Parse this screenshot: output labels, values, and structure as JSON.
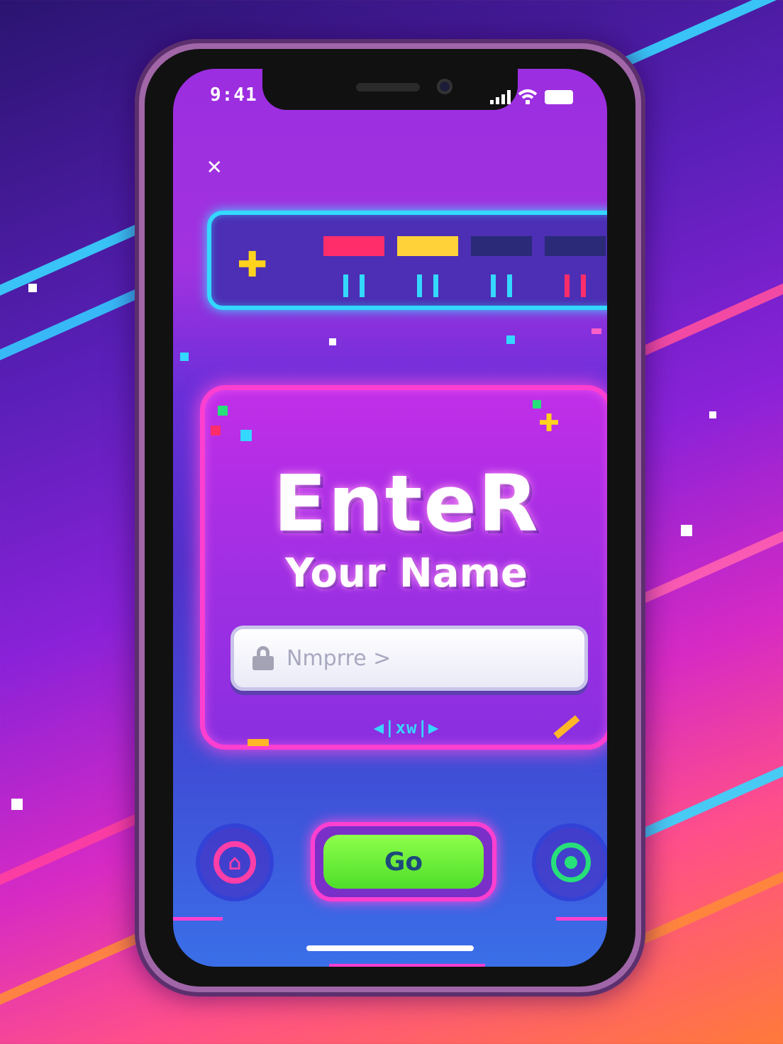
{
  "status_bar": {
    "time": "9:41"
  },
  "progress": {
    "levels": [
      {
        "bar_color": "#ff2d6a",
        "tick_color": "#34d8ff",
        "state": "complete"
      },
      {
        "bar_color": "#ffd23a",
        "tick_color": "#34d8ff",
        "state": "complete"
      },
      {
        "bar_color": "#2a2a78",
        "tick_color": "#34d8ff",
        "state": "locked"
      },
      {
        "bar_color": "#2a2a78",
        "tick_color": "#ff2d6a",
        "state": "locked"
      }
    ]
  },
  "card": {
    "title": "EnteR",
    "subtitle": "Your Name",
    "input_placeholder": "Nmprre >",
    "hint": "◀|xw|▶"
  },
  "controls": {
    "go_label": "Go"
  },
  "colors": {
    "neon_cyan": "#34d8ff",
    "neon_pink": "#ff3fd0",
    "neon_green": "#4ede2a",
    "accent_yellow": "#ffd21e"
  },
  "icons": [
    "close-icon",
    "plus-icon",
    "lock-icon",
    "home-icon",
    "target-icon",
    "wifi-icon",
    "battery-icon",
    "signal-icon"
  ]
}
